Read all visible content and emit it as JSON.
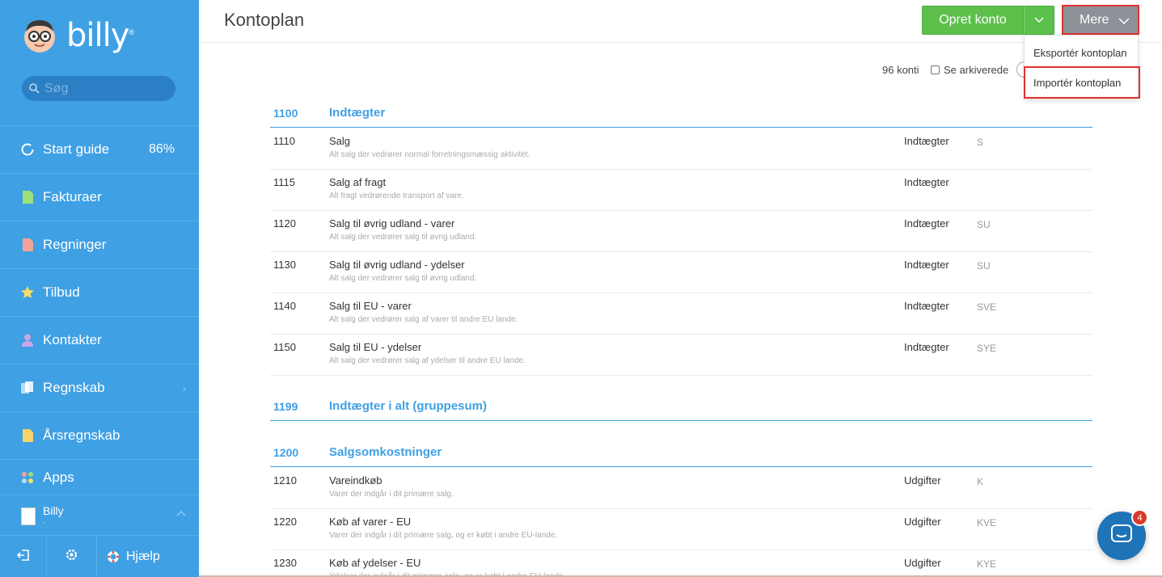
{
  "app": {
    "name": "billy",
    "colors": {
      "sidebar": "#3fa0e4",
      "accent": "#3fa0e4",
      "create_button": "#5cc04b",
      "more_button": "#8c9298",
      "highlight": "#e03131",
      "chat": "#1f73b7"
    }
  },
  "sidebar": {
    "search_placeholder": "Søg",
    "items": [
      {
        "label": "Start guide",
        "icon": "progress-circle-icon",
        "badge": "86%"
      },
      {
        "label": "Fakturaer",
        "icon": "invoice-icon"
      },
      {
        "label": "Regninger",
        "icon": "bill-icon"
      },
      {
        "label": "Tilbud",
        "icon": "star-icon"
      },
      {
        "label": "Kontakter",
        "icon": "person-icon"
      },
      {
        "label": "Regnskab",
        "icon": "ledger-icon",
        "chevron": "›"
      },
      {
        "label": "Årsregnskab",
        "icon": "annual-report-icon"
      },
      {
        "label": "Apps",
        "icon": "apps-icon"
      }
    ],
    "user": {
      "name": "Billy",
      "sub": "·"
    },
    "bottom": {
      "help_label": "Hjælp"
    }
  },
  "header": {
    "title": "Kontoplan",
    "create_label": "Opret konto",
    "more_label": "Mere"
  },
  "dropdown": {
    "items": [
      {
        "label": "Eksportér kontoplan"
      },
      {
        "label": "Importér kontoplan"
      }
    ]
  },
  "toolbar": {
    "count": "96 konti",
    "archive_label": "Se arkiverede"
  },
  "groups": [
    {
      "number": "1100",
      "name": "Indtægter",
      "rows": [
        {
          "number": "1110",
          "name": "Salg",
          "desc": "Alt salg der vedrører normal forretningsmæssig aktivitet.",
          "type": "Indtægter",
          "code": "S"
        },
        {
          "number": "1115",
          "name": "Salg af fragt",
          "desc": "Alt fragt vedrørende transport af vare.",
          "type": "Indtægter",
          "code": ""
        },
        {
          "number": "1120",
          "name": "Salg til øvrig udland - varer",
          "desc": "Alt salg der vedrører salg til øvrig udland.",
          "type": "Indtægter",
          "code": "SU"
        },
        {
          "number": "1130",
          "name": "Salg til øvrig udland - ydelser",
          "desc": "Alt salg der vedrører salg til øvrig udland.",
          "type": "Indtægter",
          "code": "SU"
        },
        {
          "number": "1140",
          "name": "Salg til EU - varer",
          "desc": "Alt salg der vedrører salg af varer til andre EU lande.",
          "type": "Indtægter",
          "code": "SVE"
        },
        {
          "number": "1150",
          "name": "Salg til EU - ydelser",
          "desc": "Alt salg der vedrører salg af ydelser til andre EU lande.",
          "type": "Indtægter",
          "code": "SYE"
        }
      ]
    },
    {
      "number": "1199",
      "name": "Indtægter i alt (gruppesum)",
      "rows": []
    },
    {
      "number": "1200",
      "name": "Salgsomkostninger",
      "rows": [
        {
          "number": "1210",
          "name": "Vareindkøb",
          "desc": "Varer der indgår i dit primære salg.",
          "type": "Udgifter",
          "code": "K"
        },
        {
          "number": "1220",
          "name": "Køb af varer - EU",
          "desc": "Varer der indgår i dit primære salg, og er købt i andre EU-lande.",
          "type": "Udgifter",
          "code": "KVE"
        },
        {
          "number": "1230",
          "name": "Køb af ydelser - EU",
          "desc": "Ydelser der indgår i dit primære salg, og er købt i andre EU-lande.",
          "type": "Udgifter",
          "code": "KYE"
        }
      ]
    }
  ],
  "chat": {
    "badge": "4"
  }
}
